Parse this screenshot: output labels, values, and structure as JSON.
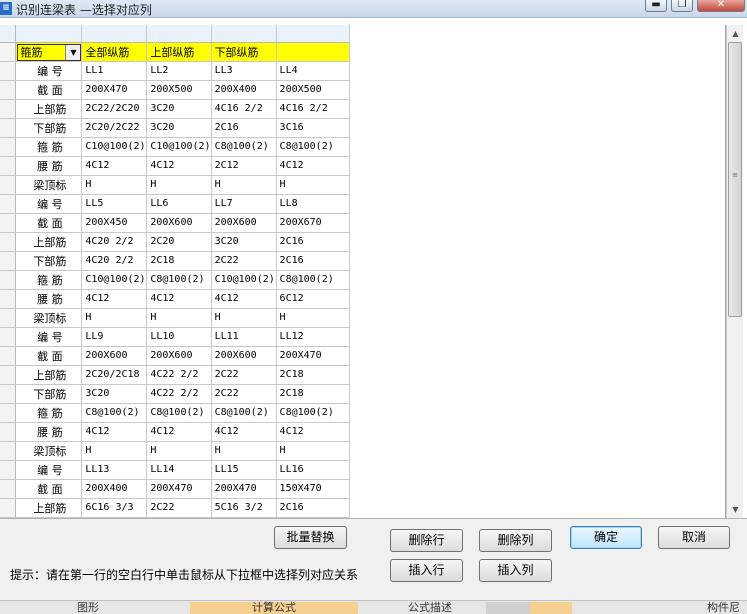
{
  "window": {
    "title": "识别连梁表 —选择对应列",
    "controls": {
      "minimize": "▬",
      "maximize": "❐",
      "close": "✕"
    }
  },
  "grid": {
    "combo_value": "箍筋",
    "mapping_row": [
      "全部纵筋",
      "上部纵筋",
      "下部纵筋",
      ""
    ],
    "rows": [
      {
        "label": "编 号",
        "values": [
          "LL1",
          "LL2",
          "LL3",
          "LL4"
        ]
      },
      {
        "label": "截 面",
        "values": [
          "200X470",
          "200X500",
          "200X400",
          "200X500"
        ]
      },
      {
        "label": "上部筋",
        "values": [
          "2C22/2C20",
          "3C20",
          "4C16 2/2",
          "4C16 2/2"
        ]
      },
      {
        "label": "下部筋",
        "values": [
          "2C20/2C22",
          "3C20",
          "2C16",
          "3C16"
        ]
      },
      {
        "label": "箍 筋",
        "values": [
          "C10@100(2)",
          "C10@100(2)",
          "C8@100(2)",
          "C8@100(2)"
        ]
      },
      {
        "label": "腰 筋",
        "values": [
          "4C12",
          "4C12",
          "2C12",
          "4C12"
        ]
      },
      {
        "label": "梁顶标",
        "values": [
          "H",
          "H",
          "H",
          "H"
        ]
      },
      {
        "label": "编 号",
        "values": [
          "LL5",
          "LL6",
          "LL7",
          "LL8"
        ]
      },
      {
        "label": "截 面",
        "values": [
          "200X450",
          "200X600",
          "200X600",
          "200X670"
        ]
      },
      {
        "label": "上部筋",
        "values": [
          "4C20 2/2",
          "2C20",
          "3C20",
          "2C16"
        ]
      },
      {
        "label": "下部筋",
        "values": [
          "4C20 2/2",
          "2C18",
          "2C22",
          "2C16"
        ]
      },
      {
        "label": "箍 筋",
        "values": [
          "C10@100(2)",
          "C8@100(2)",
          "C10@100(2)",
          "C8@100(2)"
        ]
      },
      {
        "label": "腰 筋",
        "values": [
          "4C12",
          "4C12",
          "4C12",
          "6C12"
        ]
      },
      {
        "label": "梁顶标",
        "values": [
          "H",
          "H",
          "H",
          "H"
        ]
      },
      {
        "label": "编 号",
        "values": [
          "LL9",
          "LL10",
          "LL11",
          "LL12"
        ]
      },
      {
        "label": "截 面",
        "values": [
          "200X600",
          "200X600",
          "200X600",
          "200X470"
        ]
      },
      {
        "label": "上部筋",
        "values": [
          "2C20/2C18",
          "4C22 2/2",
          "2C22",
          "2C18"
        ]
      },
      {
        "label": "下部筋",
        "values": [
          "3C20",
          "4C22 2/2",
          "2C22",
          "2C18"
        ]
      },
      {
        "label": "箍 筋",
        "values": [
          "C8@100(2)",
          "C8@100(2)",
          "C8@100(2)",
          "C8@100(2)"
        ]
      },
      {
        "label": "腰 筋",
        "values": [
          "4C12",
          "4C12",
          "4C12",
          "4C12"
        ]
      },
      {
        "label": "梁顶标",
        "values": [
          "H",
          "H",
          "H",
          "H"
        ]
      },
      {
        "label": "编 号",
        "values": [
          "LL13",
          "LL14",
          "LL15",
          "LL16"
        ]
      },
      {
        "label": "截 面",
        "values": [
          "200X400",
          "200X470",
          "200X470",
          "150X470"
        ]
      },
      {
        "label": "上部筋",
        "values": [
          "6C16 3/3",
          "2C22",
          "5C16 3/2",
          "2C16"
        ]
      }
    ]
  },
  "buttons": {
    "batch_replace": "批量替换",
    "delete_row": "删除行",
    "delete_column": "删除列",
    "ok": "确定",
    "cancel": "取消",
    "insert_row": "插入行",
    "insert_column": "插入列"
  },
  "hint": "提示：请在第一行的空白行中单击鼠标从下拉框中选择列对应关系",
  "background_tabs": [
    "图形",
    "计算公式",
    "公式描述",
    "构件尼"
  ],
  "icons": {
    "combo_arrow": "▼",
    "scroll_up": "▲",
    "scroll_down": "▼",
    "scroll_grip": "≡"
  }
}
